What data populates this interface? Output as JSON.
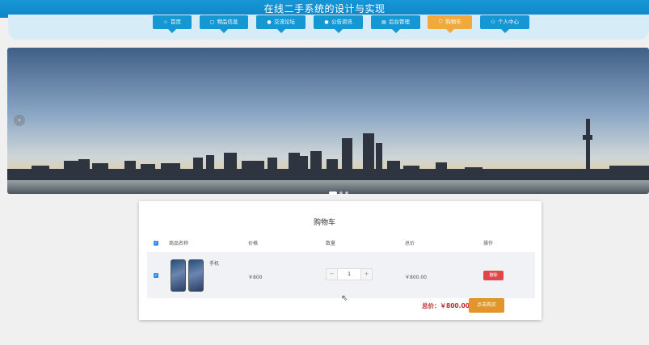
{
  "app": {
    "title": "在线二手系统的设计与实现"
  },
  "nav": {
    "items": [
      {
        "label": "首页",
        "icon": "star-icon",
        "active": false
      },
      {
        "label": "物品信息",
        "icon": "bag-icon",
        "active": false
      },
      {
        "label": "交流论坛",
        "icon": "info-icon",
        "active": false
      },
      {
        "label": "公告资讯",
        "icon": "info-icon",
        "active": false
      },
      {
        "label": "后台管理",
        "icon": "grid-icon",
        "active": false
      },
      {
        "label": "购物车",
        "icon": "cart-icon",
        "active": true
      },
      {
        "label": "个人中心",
        "icon": "user-icon",
        "active": false
      }
    ]
  },
  "carousel": {
    "slide_count": 3,
    "active_slide": 1
  },
  "cart": {
    "title": "购物车",
    "columns": [
      "商品名称",
      "价格",
      "数量",
      "总价",
      "操作"
    ],
    "rows": [
      {
        "name": "手机",
        "price": "￥800",
        "quantity": "1",
        "total": "￥800.00",
        "action": "删除",
        "checked": true
      }
    ],
    "total_label": "总价：",
    "total_value": "￥800.00",
    "buy_label": "点击购买"
  },
  "colors": {
    "primary": "#1597d3",
    "accent": "#f0a93a",
    "danger": "#e0474d",
    "buy": "#e0962a"
  }
}
